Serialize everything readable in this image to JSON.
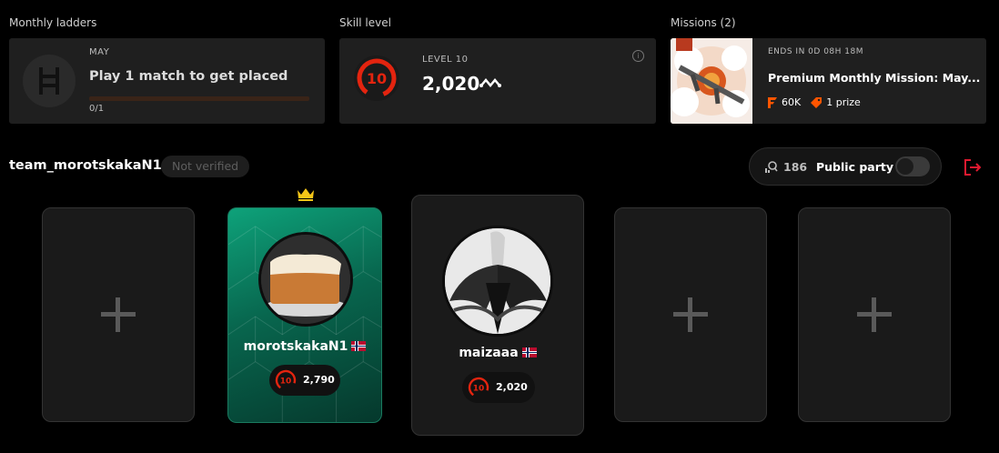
{
  "ladders": {
    "section_label": "Monthly ladders",
    "month": "MAY",
    "title": "Play 1 match to get placed",
    "progress_text": "0/1",
    "progress": 0
  },
  "skill": {
    "section_label": "Skill level",
    "level_label": "LEVEL 10",
    "level_number": "10",
    "elo": "2,020",
    "info_icon": "i"
  },
  "missions": {
    "section_label": "Missions (2)",
    "ends_in": "ENDS IN 0D 08H 18M",
    "title": "Premium Monthly Mission: May...",
    "points": "60K",
    "prize": "1 prize"
  },
  "team": {
    "name": "team_morotskakaN1",
    "verification": "Not verified"
  },
  "party": {
    "count": "186",
    "label": "Public party",
    "public": false
  },
  "players": [
    {
      "name": "morotskakaN1",
      "level": "10",
      "elo": "2,790",
      "leader": true
    },
    {
      "name": "maizaaa",
      "level": "10",
      "elo": "2,020",
      "leader": false
    }
  ],
  "colors": {
    "accent": "#ff5500",
    "level_red": "#e3240f",
    "leader_green": "#0ea27a",
    "crown": "#f5c518",
    "leave": "#e1192f"
  }
}
